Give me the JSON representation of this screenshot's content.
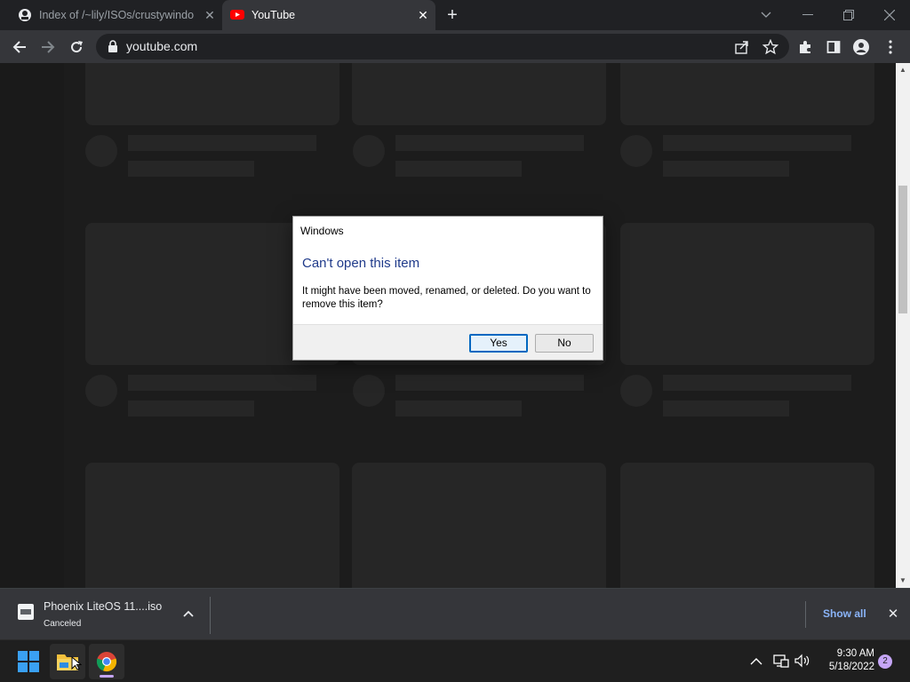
{
  "browser": {
    "tabs": [
      {
        "title": "Index of /~lily/ISOs/crustywindo",
        "active": false
      },
      {
        "title": "YouTube",
        "active": true
      }
    ],
    "url": "youtube.com"
  },
  "dialog": {
    "caption": "Windows",
    "heading": "Can't open this item",
    "message": "It might have been moved, renamed, or deleted. Do you want to remove this item?",
    "yes_label": "Yes",
    "no_label": "No"
  },
  "download_shelf": {
    "filename": "Phoenix LiteOS 11....iso",
    "status": "Canceled",
    "show_all_label": "Show all"
  },
  "taskbar": {
    "time": "9:30 AM",
    "date": "5/18/2022",
    "notification_count": "2"
  },
  "colors": {
    "dialog_heading": "#1f3a8a",
    "link_blue": "#8ab4f8",
    "youtube_red": "#ff0000",
    "accent_purple": "#c5a5f5"
  }
}
